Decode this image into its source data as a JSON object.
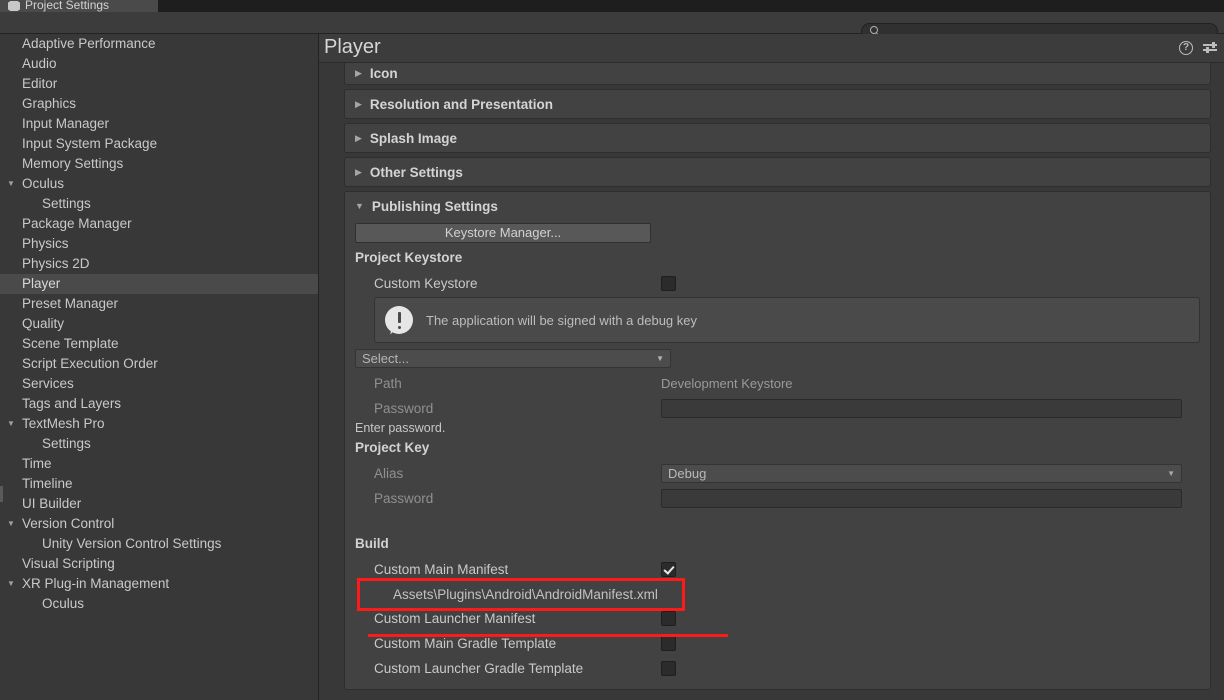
{
  "window": {
    "tab_label": "Project Settings",
    "tab_icon": "gear-icon"
  },
  "search": {
    "value": "",
    "placeholder": "",
    "icon": "search-icon"
  },
  "sidebar": {
    "items": [
      {
        "label": "Adaptive Performance",
        "depth": 0,
        "arrow": "",
        "selected": false
      },
      {
        "label": "Audio",
        "depth": 0,
        "arrow": "",
        "selected": false
      },
      {
        "label": "Editor",
        "depth": 0,
        "arrow": "",
        "selected": false
      },
      {
        "label": "Graphics",
        "depth": 0,
        "arrow": "",
        "selected": false
      },
      {
        "label": "Input Manager",
        "depth": 0,
        "arrow": "",
        "selected": false
      },
      {
        "label": "Input System Package",
        "depth": 0,
        "arrow": "",
        "selected": false
      },
      {
        "label": "Memory Settings",
        "depth": 0,
        "arrow": "",
        "selected": false
      },
      {
        "label": "Oculus",
        "depth": 0,
        "arrow": "▼",
        "selected": false
      },
      {
        "label": "Settings",
        "depth": 1,
        "arrow": "",
        "selected": false
      },
      {
        "label": "Package Manager",
        "depth": 0,
        "arrow": "",
        "selected": false
      },
      {
        "label": "Physics",
        "depth": 0,
        "arrow": "",
        "selected": false
      },
      {
        "label": "Physics 2D",
        "depth": 0,
        "arrow": "",
        "selected": false
      },
      {
        "label": "Player",
        "depth": 0,
        "arrow": "",
        "selected": true
      },
      {
        "label": "Preset Manager",
        "depth": 0,
        "arrow": "",
        "selected": false
      },
      {
        "label": "Quality",
        "depth": 0,
        "arrow": "",
        "selected": false
      },
      {
        "label": "Scene Template",
        "depth": 0,
        "arrow": "",
        "selected": false
      },
      {
        "label": "Script Execution Order",
        "depth": 0,
        "arrow": "",
        "selected": false
      },
      {
        "label": "Services",
        "depth": 0,
        "arrow": "",
        "selected": false
      },
      {
        "label": "Tags and Layers",
        "depth": 0,
        "arrow": "",
        "selected": false
      },
      {
        "label": "TextMesh Pro",
        "depth": 0,
        "arrow": "▼",
        "selected": false
      },
      {
        "label": "Settings",
        "depth": 1,
        "arrow": "",
        "selected": false
      },
      {
        "label": "Time",
        "depth": 0,
        "arrow": "",
        "selected": false
      },
      {
        "label": "Timeline",
        "depth": 0,
        "arrow": "",
        "selected": false
      },
      {
        "label": "UI Builder",
        "depth": 0,
        "arrow": "",
        "selected": false
      },
      {
        "label": "Version Control",
        "depth": 0,
        "arrow": "▼",
        "selected": false
      },
      {
        "label": "Unity Version Control Settings",
        "depth": 1,
        "arrow": "",
        "selected": false
      },
      {
        "label": "Visual Scripting",
        "depth": 0,
        "arrow": "",
        "selected": false
      },
      {
        "label": "XR Plug-in Management",
        "depth": 0,
        "arrow": "▼",
        "selected": false
      },
      {
        "label": "Oculus",
        "depth": 1,
        "arrow": "",
        "selected": false
      }
    ]
  },
  "panel": {
    "title": "Player",
    "help_icon": "help-icon",
    "preset_icon": "preset-icon",
    "foldouts": [
      {
        "label": "Icon",
        "arrow": "▶",
        "expanded": false
      },
      {
        "label": "Resolution and Presentation",
        "arrow": "▶",
        "expanded": false
      },
      {
        "label": "Splash Image",
        "arrow": "▶",
        "expanded": false
      },
      {
        "label": "Other Settings",
        "arrow": "▶",
        "expanded": false
      },
      {
        "label": "Publishing Settings",
        "arrow": "▼",
        "expanded": true
      }
    ]
  },
  "publishing": {
    "keystore_manager_button": "Keystore Manager...",
    "project_keystore_heading": "Project Keystore",
    "custom_keystore_label": "Custom Keystore",
    "custom_keystore_checked": false,
    "info_message": "The application will be signed with a debug key",
    "info_icon": "warning-icon",
    "keystore_select_value": "Select...",
    "keystore_select_arrow": "▼",
    "path_label": "Path",
    "path_value": "Development Keystore",
    "keystore_password_label": "Password",
    "keystore_password_value": "",
    "password_hint": "Enter password.",
    "project_key_heading": "Project Key",
    "alias_label": "Alias",
    "alias_value": "Debug",
    "alias_arrow": "▼",
    "key_password_label": "Password",
    "key_password_value": "",
    "build_heading": "Build",
    "build_rows": [
      {
        "label": "Custom Main Manifest",
        "checked": true
      },
      {
        "label": "Custom Launcher Manifest",
        "checked": false
      },
      {
        "label": "Custom Main Gradle Template",
        "checked": false
      },
      {
        "label": "Custom Launcher Gradle Template",
        "checked": false
      }
    ],
    "manifest_path": "Assets\\Plugins\\Android\\AndroidManifest.xml"
  },
  "annotations": {
    "accent_color": "#ff1a1a",
    "highlight_rect_target": "Custom Main Manifest row",
    "underline_target": "Assets\\Plugins\\Android\\AndroidManifest.xml"
  }
}
